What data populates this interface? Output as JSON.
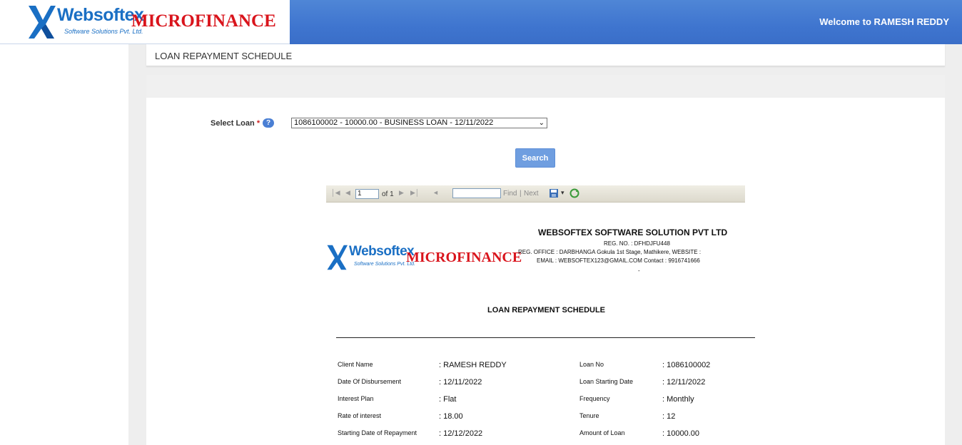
{
  "brand": {
    "word": "Websoftex",
    "sub": "Software Solutions Pvt. Ltd.",
    "product": "MICROFINANCE"
  },
  "header": {
    "welcome": "Welcome to RAMESH REDDY"
  },
  "page": {
    "title": "LOAN REPAYMENT SCHEDULE"
  },
  "form": {
    "select_label": "Select Loan",
    "required_mark": "*",
    "help": "?",
    "selected_loan": "1086100002 - 10000.00 - BUSINESS LOAN - 12/11/2022",
    "search_label": "Search"
  },
  "toolbar": {
    "page_value": "1",
    "of_text": "of 1",
    "find_label": "Find",
    "separator": "|",
    "next_label": "Next"
  },
  "report": {
    "company": "WEBSOFTEX SOFTWARE SOLUTION PVT LTD",
    "reg_no": "REG. NO. : DFHDJFU448",
    "reg_office": "REG. OFFICE : DARBHANGA  Gokula 1st Stage, Mathikere, WEBSITE :",
    "email": "EMAIL : WEBSOFTEX123@GMAIL.COM   Contact : 9916741666",
    "dash": "-",
    "title": "LOAN REPAYMENT SCHEDULE",
    "left_fields": [
      {
        "label": "Client Name",
        "value": "RAMESH  REDDY"
      },
      {
        "label": "Date Of Disbursement",
        "value": "12/11/2022"
      },
      {
        "label": "Interest Plan",
        "value": "Flat"
      },
      {
        "label": "Rate of interest",
        "value": "18.00"
      },
      {
        "label": "Starting Date of Repayment",
        "value": "12/12/2022"
      }
    ],
    "right_fields": [
      {
        "label": "Loan No",
        "value": "1086100002"
      },
      {
        "label": "Loan Starting Date",
        "value": "12/11/2022"
      },
      {
        "label": "Frequency",
        "value": "Monthly"
      },
      {
        "label": "Tenure",
        "value": "12"
      },
      {
        "label": "Amount of Loan",
        "value": "10000.00"
      }
    ]
  }
}
